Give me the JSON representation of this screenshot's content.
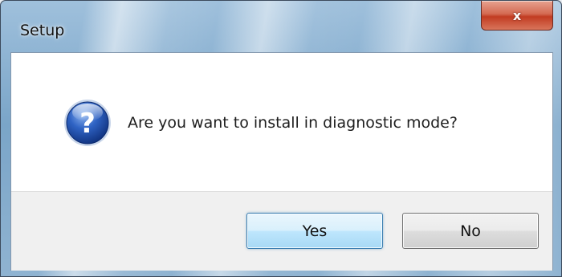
{
  "window": {
    "title": "Setup",
    "close_label": "x"
  },
  "dialog": {
    "icon": "question-icon",
    "message": "Are you want to install in diagnostic mode?"
  },
  "buttons": {
    "yes_label": "Yes",
    "no_label": "No"
  },
  "colors": {
    "title_bar": "#7aa5c8",
    "close_button": "#c23c22",
    "icon_blue": "#1f4e9c",
    "default_button_border": "#3c7fb1",
    "button_bar": "#f0f0f0"
  }
}
